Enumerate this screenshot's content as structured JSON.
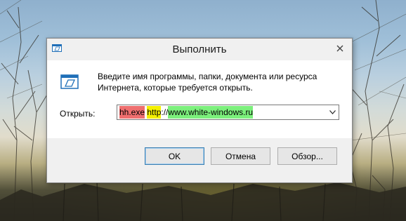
{
  "window": {
    "title": "Выполнить",
    "title_icon": "run-app-icon",
    "close_icon": "close-icon"
  },
  "content": {
    "icon": "run-icon",
    "description": "Введите имя программы, папки, документа или ресурса Интернета, которые требуется открыть.",
    "open_label": "Открыть:",
    "open_input": {
      "value": "hh.exe http://www.white-windows.ru",
      "segments": {
        "s1": "hh.exe",
        "s2": " ",
        "s3": "http",
        "s4": "://",
        "s5": "www.white-windows.ru"
      },
      "highlight_colors": {
        "red": "#ef6f6f",
        "yellow": "#f4f000",
        "green": "#7cf07c"
      },
      "dropdown_icon": "chevron-down-icon"
    }
  },
  "buttons": {
    "ok": "OK",
    "cancel": "Отмена",
    "browse": "Обзор..."
  },
  "colors": {
    "dialog_bg": "#ffffff",
    "footer_bg": "#f0f0f0",
    "default_button_border": "#3c7fb1"
  }
}
